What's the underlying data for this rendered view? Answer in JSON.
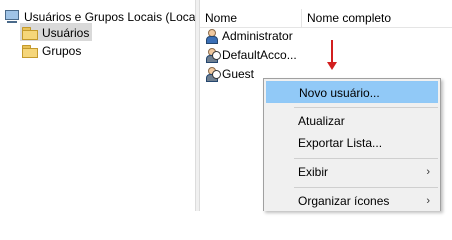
{
  "tree": {
    "root_label": "Usuários e Grupos Locais (Local)",
    "users_label": "Usuários",
    "groups_label": "Grupos"
  },
  "list": {
    "columns": [
      "Nome",
      "Nome completo"
    ],
    "items": [
      {
        "name": "Administrator",
        "full_name": ""
      },
      {
        "name": "DefaultAcco...",
        "full_name": ""
      },
      {
        "name": "Guest",
        "full_name": ""
      }
    ]
  },
  "context_menu": {
    "items": [
      {
        "label": "Novo usuário...",
        "highlighted": true
      },
      {
        "label": "Atualizar"
      },
      {
        "label": "Exportar Lista..."
      },
      {
        "label": "Exibir",
        "submenu": "›"
      },
      {
        "label": "Organizar ícones",
        "submenu": "›"
      }
    ]
  },
  "annotation": {
    "arrow_color": "#d21f1f"
  }
}
